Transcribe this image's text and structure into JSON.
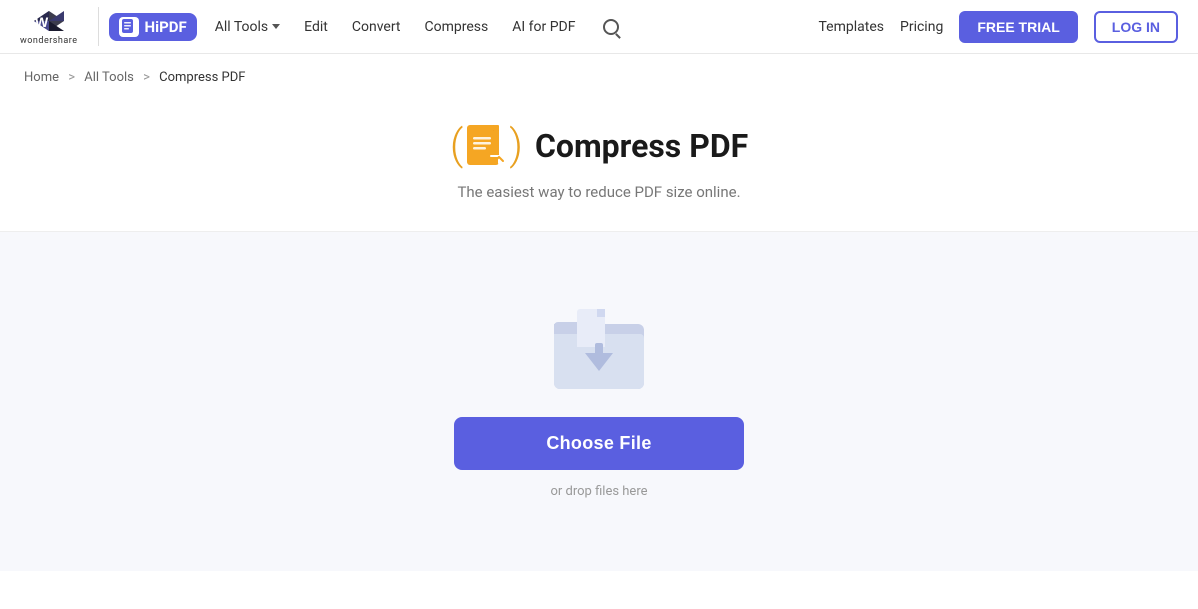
{
  "header": {
    "wondershare_text": "wondershare",
    "hipdf_label": "HiPDF",
    "nav_all_tools": "All Tools",
    "nav_edit": "Edit",
    "nav_convert": "Convert",
    "nav_compress": "Compress",
    "nav_ai_for_pdf": "AI for PDF",
    "nav_templates": "Templates",
    "nav_pricing": "Pricing",
    "btn_free_trial": "FREE TRIAL",
    "btn_login": "LOG IN"
  },
  "breadcrumb": {
    "home": "Home",
    "all_tools": "All Tools",
    "current": "Compress PDF",
    "sep1": ">",
    "sep2": ">"
  },
  "hero": {
    "title": "Compress PDF",
    "subtitle": "The easiest way to reduce PDF size online.",
    "paren_left": "(",
    "paren_right": ")"
  },
  "upload": {
    "choose_file_label": "Choose File",
    "drop_text": "or drop files here"
  }
}
